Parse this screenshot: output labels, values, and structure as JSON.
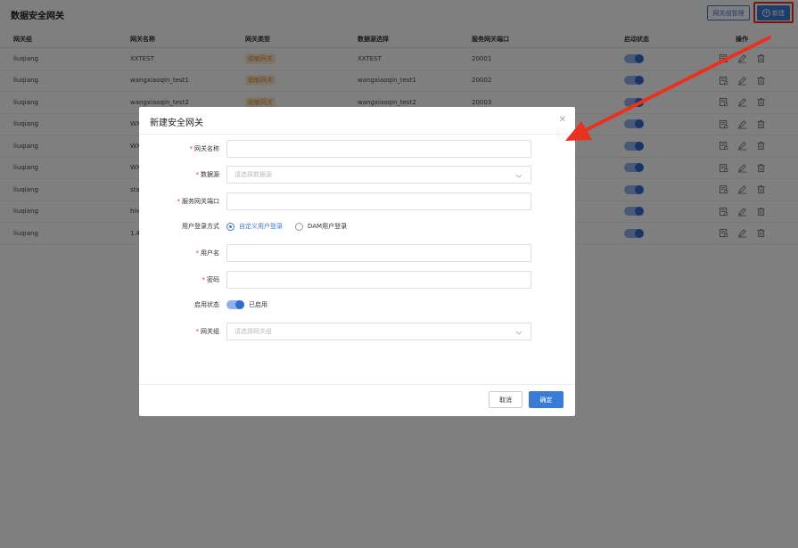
{
  "page": {
    "title": "数据安全网关",
    "btn_manage": "网关组管理",
    "btn_new": "新建"
  },
  "table": {
    "headers": [
      "网关组",
      "网关名称",
      "网关类型",
      "数据源选择",
      "服务网关端口",
      "启动状态",
      "操作"
    ],
    "rows": [
      {
        "group": "liuqiang",
        "name": "XXTEST",
        "type": "脱敏网关",
        "source": "XXTEST",
        "port": "20001"
      },
      {
        "group": "liuqiang",
        "name": "wangxiaoqin_test1",
        "type": "脱敏网关",
        "source": "wangxiaoqin_test1",
        "port": "20002"
      },
      {
        "group": "liuqiang",
        "name": "wangxiaoqin_test2",
        "type": "脱敏网关",
        "source": "wangxiaoqin_test2",
        "port": "20003"
      },
      {
        "group": "liuqiang",
        "name": "WX",
        "type": "",
        "source": "",
        "port": ""
      },
      {
        "group": "liuqiang",
        "name": "WX",
        "type": "",
        "source": "",
        "port": ""
      },
      {
        "group": "liuqiang",
        "name": "WX",
        "type": "",
        "source": "",
        "port": ""
      },
      {
        "group": "liuqiang",
        "name": "sta",
        "type": "",
        "source": "",
        "port": ""
      },
      {
        "group": "liuqiang",
        "name": "hiv",
        "type": "",
        "source": "",
        "port": ""
      },
      {
        "group": "liuqiang",
        "name": "1.4",
        "type": "",
        "source": "",
        "port": ""
      }
    ]
  },
  "modal": {
    "title": "新建安全网关",
    "fields": {
      "name_label": "网关名称",
      "source_label": "数据源",
      "source_placeholder": "请选择数据源",
      "port_label": "服务网关端口",
      "login_label": "用户登录方式",
      "login_opt1": "自定义用户登录",
      "login_opt2": "DAM用户登录",
      "user_label": "用户名",
      "pwd_label": "密码",
      "status_label": "启用状态",
      "status_value": "已启用",
      "group_label": "网关组",
      "group_placeholder": "请选择网关组"
    },
    "btn_cancel": "取消",
    "btn_ok": "确定"
  },
  "colors": {
    "primary": "#3a7bd5",
    "highlight": "#e8321f",
    "tag_bg": "#fdecd8"
  }
}
